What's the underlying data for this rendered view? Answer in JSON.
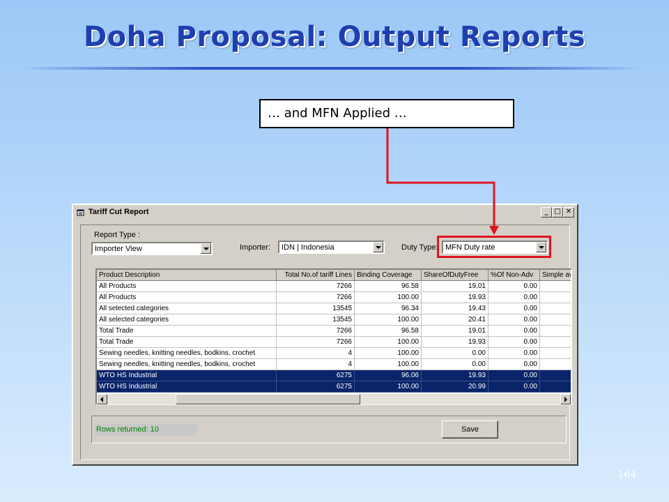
{
  "slide": {
    "title": "Doha Proposal: Output Reports",
    "callout": "… and MFN Applied …",
    "page_number": "164",
    "accent_color": "#e0141e"
  },
  "window": {
    "title": "Tariff Cut Report",
    "icon": "report-app-icon",
    "controls": {
      "minimize": "_",
      "maximize": "□",
      "close": "✕"
    }
  },
  "form": {
    "report_type_label": "Report Type :",
    "report_type_value": "Importer View",
    "importer_label": "Importer:",
    "importer_value": "IDN | Indonesia",
    "duty_type_label": "Duty Type:",
    "duty_type_value": "MFN Duty rate"
  },
  "grid": {
    "headers": [
      "Product Description",
      "Total No.of tariff Lines",
      "Binding Coverage",
      "ShareOfDutyFree",
      "%Of Non-Adv",
      "Simple av"
    ],
    "rows": [
      [
        "All Products",
        "7266",
        "96.58",
        "19.01",
        "0.00"
      ],
      [
        "All Products",
        "7266",
        "100.00",
        "19.93",
        "0.00"
      ],
      [
        "All selected categories",
        "13545",
        "96.34",
        "19.43",
        "0.00"
      ],
      [
        "All selected categories",
        "13545",
        "100.00",
        "20.41",
        "0.00"
      ],
      [
        "Total Trade",
        "7266",
        "96.58",
        "19.01",
        "0.00"
      ],
      [
        "Total Trade",
        "7266",
        "100.00",
        "19.93",
        "0.00"
      ],
      [
        "Sewing needles, knitting needles, bodkins, crochet",
        "4",
        "100.00",
        "0.00",
        "0.00"
      ],
      [
        "Sewing needles, knitting needles, bodkins, crochet",
        "4",
        "100.00",
        "0.00",
        "0.00"
      ],
      [
        "WTO HS Industrial",
        "6275",
        "96.06",
        "19.93",
        "0.00"
      ],
      [
        "WTO HS Industrial",
        "6275",
        "100.00",
        "20.99",
        "0.00"
      ]
    ],
    "selected_rows": [
      8,
      9
    ]
  },
  "status": {
    "rows_returned": "Rows returned: 10",
    "save_label": "Save"
  }
}
